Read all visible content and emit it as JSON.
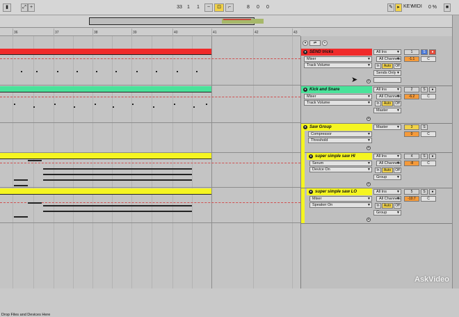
{
  "transport": {
    "position": [
      "33",
      "1",
      "1"
    ],
    "loop_length": [
      "8",
      "0",
      "0"
    ]
  },
  "top_right": {
    "key_label": "KEY",
    "midi_label": "MIDI",
    "cpu_value": "0 %"
  },
  "ruler": {
    "bars": [
      "36",
      "37",
      "38",
      "39",
      "40",
      "41",
      "42",
      "43"
    ]
  },
  "tracks": [
    {
      "name": "SEND tricks",
      "color": "#f02a2a",
      "devices": [
        "Mixer",
        "Track Volume"
      ],
      "input": "All Ins",
      "channel": "All Channels",
      "monitor": [
        "In",
        "Auto",
        "Off"
      ],
      "output": "Sends Only",
      "track_number": "1",
      "solo": "S",
      "volume": "-1.1",
      "pan": "C"
    },
    {
      "name": "Kick and Snare",
      "color": "#49e39a",
      "devices": [
        "Mixer",
        "Track Volume"
      ],
      "input": "All Ins",
      "channel": "All Channels",
      "monitor": [
        "In",
        "Auto",
        "Off"
      ],
      "output": "Master",
      "track_number": "2",
      "solo": "S",
      "volume": "-6.2",
      "pan": "C"
    },
    {
      "name": "Saw Group",
      "color": "#f5f521",
      "devices": [
        "Compressor",
        "Threshold"
      ],
      "output": "Master",
      "track_number": "3",
      "solo": "S",
      "volume": "0",
      "pan": "C"
    },
    {
      "name": "super simple saw HI",
      "color": "#f5f521",
      "devices": [
        "Serum",
        "Device On"
      ],
      "input": "All Ins",
      "channel": "All Channels",
      "monitor": [
        "In",
        "Auto",
        "Off"
      ],
      "output": "Group",
      "track_number": "4",
      "solo": "S",
      "volume": "-8",
      "pan": "C"
    },
    {
      "name": "super simple saw LO",
      "color": "#f5f521",
      "devices": [
        "Mixer",
        "Speaker On"
      ],
      "input": "All Ins",
      "channel": "All Channels",
      "monitor": [
        "In",
        "Auto",
        "Off"
      ],
      "output": "Group",
      "track_number": "5",
      "solo": "S",
      "volume": "-10.7",
      "pan": "C"
    }
  ],
  "drop_hint": "Drop Files and Devices Here",
  "watermark": "AskVideo",
  "colors": {
    "red_track": "#f02a2a",
    "green_track": "#49e39a",
    "yellow_track": "#f5f521",
    "volume_orange": "#f59a3a"
  }
}
